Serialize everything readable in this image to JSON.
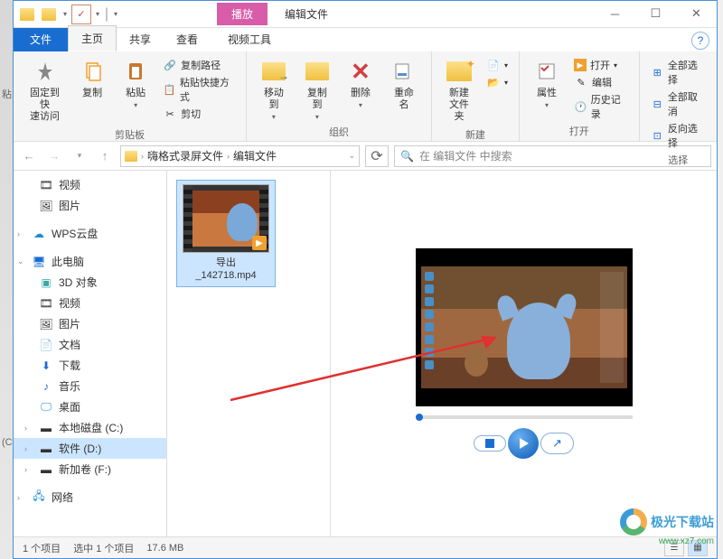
{
  "title_context": "播放",
  "window_title": "编辑文件",
  "tabs": {
    "file": "文件",
    "home": "主页",
    "share": "共享",
    "view": "查看",
    "tools": "视频工具"
  },
  "ribbon": {
    "clipboard": {
      "pin": "固定到快\n速访问",
      "copy": "复制",
      "paste": "粘贴",
      "copy_path": "复制路径",
      "paste_shortcut": "粘贴快捷方式",
      "cut": "剪切",
      "label": "剪贴板"
    },
    "organize": {
      "move": "移动到",
      "copyto": "复制到",
      "delete": "删除",
      "rename": "重命名",
      "label": "组织"
    },
    "new": {
      "folder": "新建\n文件夹",
      "label": "新建"
    },
    "open": {
      "props": "属性",
      "open": "打开",
      "edit": "编辑",
      "history": "历史记录",
      "label": "打开"
    },
    "select": {
      "all": "全部选择",
      "none": "全部取消",
      "invert": "反向选择",
      "label": "选择"
    }
  },
  "breadcrumbs": [
    "嗨格式录屏文件",
    "编辑文件"
  ],
  "search_placeholder": "在 编辑文件 中搜索",
  "nav": {
    "video": "视频",
    "pictures": "图片",
    "wps": "WPS云盘",
    "thispc": "此电脑",
    "3d": "3D 对象",
    "video2": "视频",
    "pictures2": "图片",
    "docs": "文档",
    "downloads": "下载",
    "music": "音乐",
    "desktop": "桌面",
    "diskc": "本地磁盘 (C:)",
    "diskd": "软件 (D:)",
    "diskf": "新加卷 (F:)",
    "network": "网络"
  },
  "file": {
    "name": "导出\n_142718.mp4"
  },
  "status": {
    "count": "1 个项目",
    "selected": "选中 1 个项目",
    "size": "17.6 MB"
  },
  "watermark": {
    "text": "极光下载站",
    "sub": "www.xz7.com"
  },
  "leftbg": {
    "a": "粘",
    "b": "(C"
  }
}
